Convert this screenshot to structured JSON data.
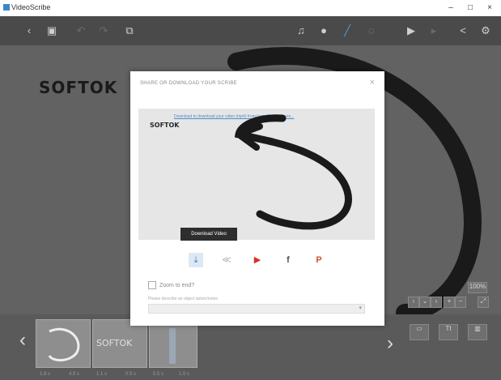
{
  "window": {
    "title": "VideoScribe",
    "minimize": "–",
    "maximize": "□",
    "close": "×"
  },
  "toolbar": {
    "icons": [
      "back-icon",
      "save-icon",
      "undo-icon",
      "redo-icon",
      "copy-icon",
      "music-icon",
      "mic-icon",
      "pen-icon",
      "hand-icon",
      "play-icon",
      "step-icon",
      "share-icon",
      "gear-icon"
    ]
  },
  "canvas": {
    "logo_text": "SOFTOK"
  },
  "modal": {
    "title": "SHARE OR DOWNLOAD YOUR SCRIBE",
    "close": "×",
    "preview_link": "Download to download your video (mp4) from here, find out more...",
    "preview_logo": "SOFTOK",
    "tooltip": "Download Video",
    "share_icons": {
      "download": "⤓",
      "embed": "≪",
      "youtube": "▶",
      "facebook": "f",
      "powerpoint": "P"
    },
    "zoom_label": "Zoom to end?",
    "description_label": "Please describe an object option/notes",
    "description_value": "",
    "description_caret": "▾"
  },
  "filmstrip": {
    "thumb_logo": "SOFTOK",
    "labels": [
      "1.8 s",
      "4.9 s",
      "1.1 s",
      "0.5 s",
      "5.5 s",
      "1.0 s"
    ]
  },
  "side_controls": {
    "zoom_badge": "100%",
    "buttons": [
      "image-icon",
      "text-icon",
      "chart-icon"
    ]
  },
  "colors": {
    "toolbar_bg": "#4a4a4a",
    "canvas_bg": "#626262",
    "accent": "#3a7fc3",
    "youtube": "#d93025"
  }
}
